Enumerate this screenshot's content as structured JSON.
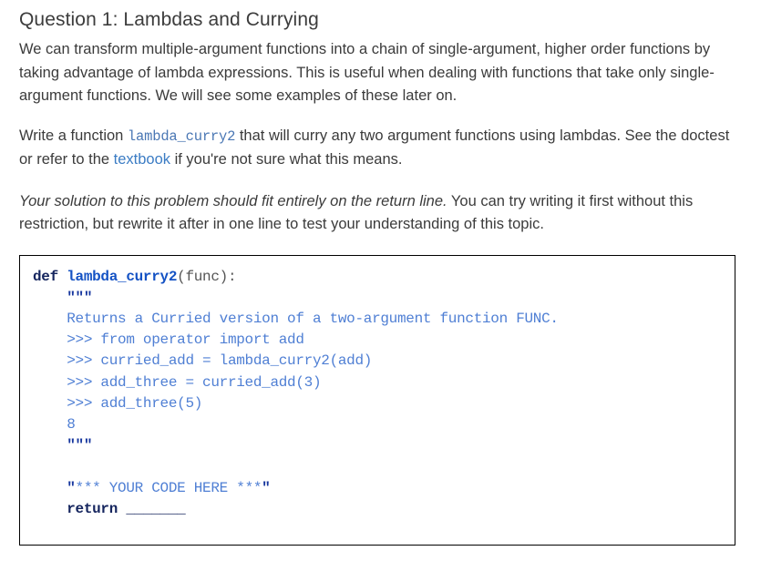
{
  "heading": {
    "title": "Question 1: Lambdas and Currying"
  },
  "paragraphs": {
    "intro": "We can transform multiple-argument functions into a chain of single-argument, higher order functions by taking advantage of lambda expressions. This is useful when dealing with functions that take only single-argument functions. We will see some examples of these later on.",
    "task_part1": "Write a function ",
    "task_code": "lambda_curry2",
    "task_part2": " that will curry any two argument functions using lambdas. See the doctest or refer to the ",
    "task_link": "textbook",
    "task_part3": " if you're not sure what this means.",
    "note_emphasis": "Your solution to this problem should fit entirely on the return line.",
    "note_rest": " You can try writing it first without this restriction, but rewrite it after in one line to test your understanding of this topic."
  },
  "code": {
    "def_keyword": "def",
    "function_name": "lambda_curry2",
    "signature": "(func):",
    "triple_quote_open": "\"\"\"",
    "doc_summary": "Returns a Curried version of a two-argument function FUNC.",
    "doctest_1": ">>> from operator import add",
    "doctest_2": ">>> curried_add = lambda_curry2(add)",
    "doctest_3": ">>> add_three = curried_add(3)",
    "doctest_4": ">>> add_three(5)",
    "doctest_output": "8",
    "triple_quote_close": "\"\"\"",
    "todo_quote_open": "\"",
    "todo_text": "*** YOUR CODE HERE ***",
    "todo_quote_close": "\"",
    "return_keyword": "return",
    "return_blank": "_______",
    "indent": "    "
  },
  "colors": {
    "keyword": "#15255e",
    "function_name": "#1452c4",
    "docstring": "#4f7fd4",
    "link": "#3b7cc4",
    "inline_code": "#4a77b4",
    "body_text": "#3b3b3b",
    "border": "#000000"
  }
}
